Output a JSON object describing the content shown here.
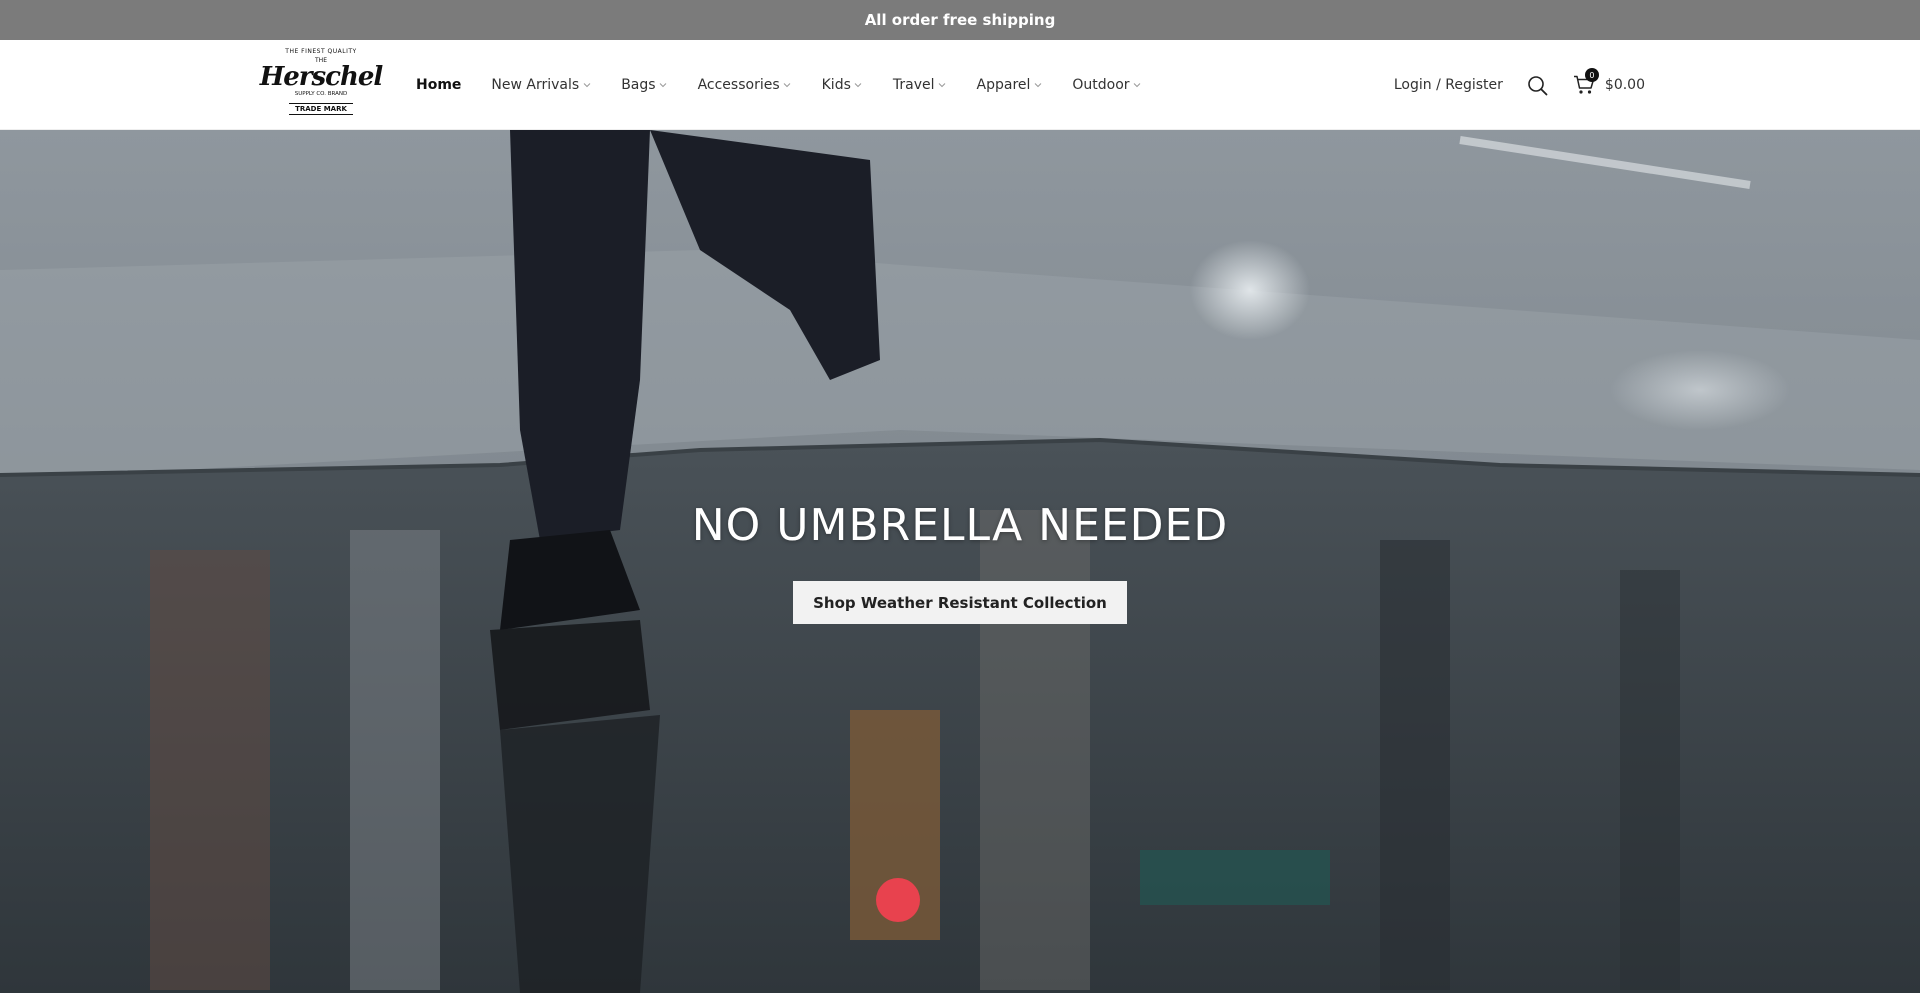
{
  "announcement": "All order free shipping",
  "logo": {
    "top_text": "THE FINEST QUALITY",
    "the_text": "THE",
    "brand": "Herschel",
    "sub_text": "SUPPLY CO. BRAND",
    "trademark": "TRADE MARK"
  },
  "nav": {
    "items": [
      {
        "label": "Home",
        "has_dropdown": false
      },
      {
        "label": "New Arrivals",
        "has_dropdown": true
      },
      {
        "label": "Bags",
        "has_dropdown": true
      },
      {
        "label": "Accessories",
        "has_dropdown": true
      },
      {
        "label": "Kids",
        "has_dropdown": true
      },
      {
        "label": "Travel",
        "has_dropdown": true
      },
      {
        "label": "Apparel",
        "has_dropdown": true
      },
      {
        "label": "Outdoor",
        "has_dropdown": true
      }
    ]
  },
  "header": {
    "login_label": "Login / Register",
    "cart_count": "0",
    "cart_total": "$0.00",
    "search_icon": "search-icon",
    "cart_icon": "cart-icon"
  },
  "hero": {
    "title": "NO UMBRELLA NEEDED",
    "button_label": "Shop Weather Resistant Collection"
  },
  "colors": {
    "announcement_bg": "#7b7b7b",
    "button_bg": "#f2f2f2"
  }
}
